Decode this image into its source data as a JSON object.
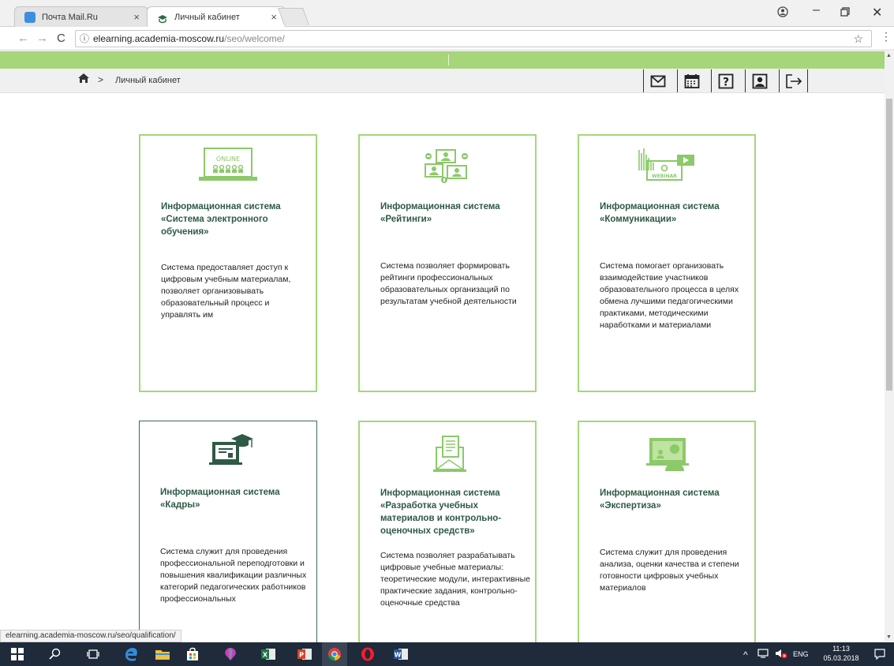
{
  "browser": {
    "tabs": [
      {
        "label": "Почта Mail.Ru",
        "close": "×"
      },
      {
        "label": "Личный кабинет",
        "close": "×"
      }
    ],
    "url_host": "elearning.academia-moscow.ru",
    "url_path": "/seo/welcome/",
    "status_url": "elearning.academia-moscow.ru/seo/qualification/"
  },
  "breadcrumb": {
    "current": "Личный кабинет"
  },
  "cards": [
    {
      "title": "Информационная система «Система электронного обучения»",
      "desc": "Система предоставляет доступ к цифровым учебным материалам, позволяет организовывать образовательный процесс и управлять им",
      "icon": "online-course-icon",
      "ill_text": "ONLINE"
    },
    {
      "title": "Информационная система «Рейтинги»",
      "desc": "Система позволяет формировать рейтинги профессиональных образовательных организаций по результатам учебной деятельности",
      "icon": "ratings-icon"
    },
    {
      "title": "Информационная система «Коммуникации»",
      "desc": "Система помогает организовать взаимодействие участников образовательного процесса в целях обмена лучшими педагогическими практиками, методическими наработками и материалами",
      "icon": "webinar-icon",
      "ill_text": "WEBINAR"
    },
    {
      "title": "Информационная система «Кадры»",
      "desc": "Система служит для проведения профессиональной переподготовки и повышения квалификации различных категорий педагогических работников профессиональных",
      "icon": "graduation-icon"
    },
    {
      "title": "Информационная система «Разработка учебных материалов и контрольно-оценочных средств»",
      "desc": "Система позволяет разрабатывать цифровые учебные материалы: теоретические модули, интерактивные практические задания, контрольно-оценочные средства",
      "icon": "document-icon"
    },
    {
      "title": "Информационная система «Экспертиза»",
      "desc": "Система служит для проведения анализа, оценки качества и степени готовности цифровых учебных материалов",
      "icon": "expert-icon"
    }
  ],
  "taskbar": {
    "lang": "ENG",
    "time": "11:13",
    "date": "05.03.2018"
  },
  "colors": {
    "accent_green": "#a6d57a",
    "card_border": "#a4d77c",
    "title_green": "#2e5a44"
  }
}
